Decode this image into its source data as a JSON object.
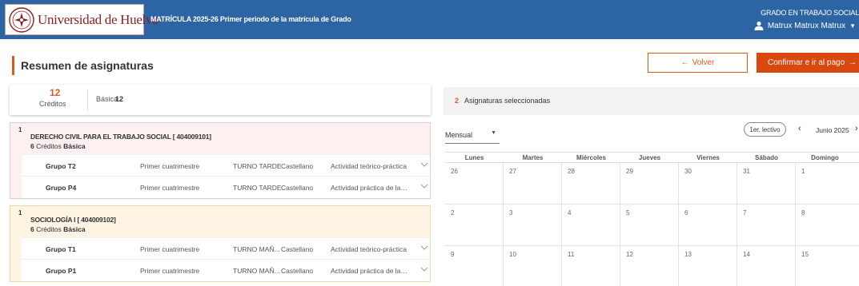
{
  "header": {
    "logo_text": "Universidad de Huelva",
    "title": "MATRÍCULA 2025-26 Primer periodo de la matrícula de Grado",
    "degree": "GRADO EN TRABAJO SOCIAL",
    "user_name": "Matrux Matrux Matrux",
    "bg_color": "#2c64a4"
  },
  "page": {
    "title": "Resumen de asignaturas",
    "back_label": "Volver",
    "confirm_label": "Confirmar e ir al pago",
    "accent_color": "#e05a1e"
  },
  "summary": {
    "credits": "12",
    "credits_label": "Créditos",
    "type_label": "Básica",
    "type_value": "12"
  },
  "subjects": [
    {
      "num": "1",
      "title": "DERECHO CIVIL PARA EL TRABAJO SOCIAL [ 404009101]",
      "credits": "6",
      "credits_word": "Créditos",
      "type": "Básica",
      "groups": [
        {
          "name": "Grupo T2",
          "period": "Primer cuatrimestre",
          "turno": "TURNO TARDE",
          "lang": "Castellano",
          "activity": "Actividad teórico-práctica"
        },
        {
          "name": "Grupo P4",
          "period": "Primer cuatrimestre",
          "turno": "TURNO TARDE",
          "lang": "Castellano",
          "activity": "Actividad práctica de laboratorio"
        }
      ]
    },
    {
      "num": "1",
      "title": "SOCIOLOGÍA I [ 404009102]",
      "credits": "6",
      "credits_word": "Créditos",
      "type": "Básica",
      "groups": [
        {
          "name": "Grupo T1",
          "period": "Primer cuatrimestre",
          "turno": "TURNO MAÑ...",
          "lang": "Castellano",
          "activity": "Actividad teórico-práctica"
        },
        {
          "name": "Grupo P1",
          "period": "Primer cuatrimestre",
          "turno": "TURNO MAÑ...",
          "lang": "Castellano",
          "activity": "Actividad práctica de laboratorio"
        }
      ]
    }
  ],
  "selection": {
    "count": "2",
    "label": "Asignaturas seleccionadas"
  },
  "calendar": {
    "view": "Mensual",
    "lectivo_label": "1er. lectivo",
    "month": "Junio 2025",
    "weekdays": [
      "Lunes",
      "Martes",
      "Miércoles",
      "Jueves",
      "Viernes",
      "Sábado",
      "Domingo"
    ],
    "weeks": [
      [
        "26",
        "27",
        "28",
        "29",
        "30",
        "31",
        "1"
      ],
      [
        "2",
        "3",
        "4",
        "5",
        "6",
        "7",
        "8"
      ],
      [
        "9",
        "10",
        "11",
        "12",
        "13",
        "14",
        "15"
      ]
    ]
  }
}
